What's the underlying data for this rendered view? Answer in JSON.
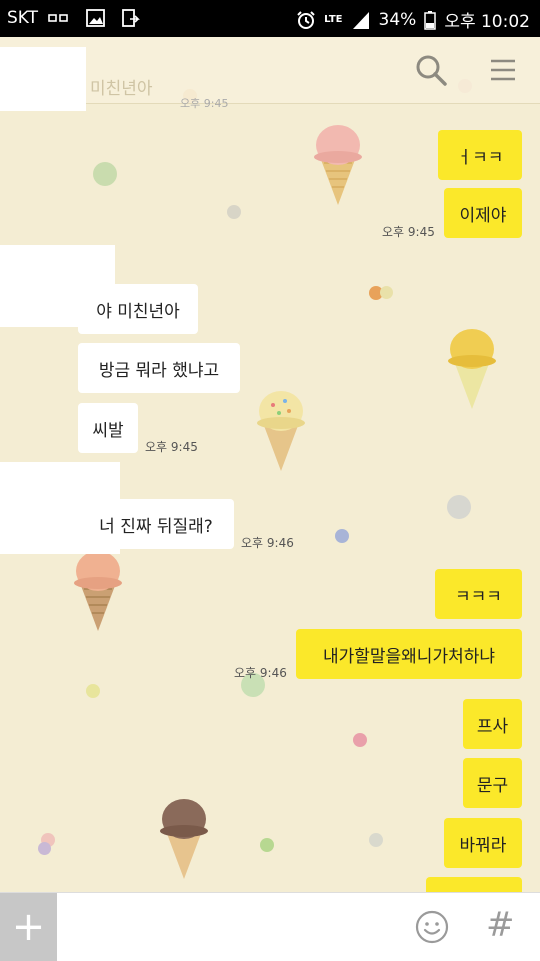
{
  "status_bar": {
    "carrier": "SKT",
    "network": "LTE",
    "battery": "34%",
    "time": "오후 10:02"
  },
  "header": {
    "title": "미친년아",
    "time": "오후 9:45",
    "search_icon": "search-icon",
    "menu_icon": "menu-icon"
  },
  "messages": [
    {
      "side": "me",
      "text": "ㅓㅋㅋ"
    },
    {
      "side": "me",
      "text": "이제야"
    },
    {
      "side": "me",
      "time": "오후 9:45"
    },
    {
      "side": "other",
      "text": "야 미친년아"
    },
    {
      "side": "other",
      "text": "방금 뭐라 했냐고"
    },
    {
      "side": "other",
      "text": "씨발"
    },
    {
      "side": "other",
      "time": "오후 9:45"
    },
    {
      "side": "other",
      "text": "너 진짜 뒤질래?"
    },
    {
      "side": "other",
      "time": "오후 9:46"
    },
    {
      "side": "me",
      "text": "ㅋㅋㅋ"
    },
    {
      "side": "me",
      "text": "내가할말을왜니가처하냐"
    },
    {
      "side": "me",
      "time": "오후 9:46"
    },
    {
      "side": "me",
      "text": "프사"
    },
    {
      "side": "me",
      "text": "문구"
    },
    {
      "side": "me",
      "text": "바꿔라"
    }
  ],
  "bottom_bar": {
    "plus_label": "+",
    "emoji_icon": "smiley-icon",
    "hash_label": "#"
  },
  "colors": {
    "my_bubble": "#fbe82a",
    "other_bubble": "#ffffff",
    "background": "#f4edd3"
  }
}
